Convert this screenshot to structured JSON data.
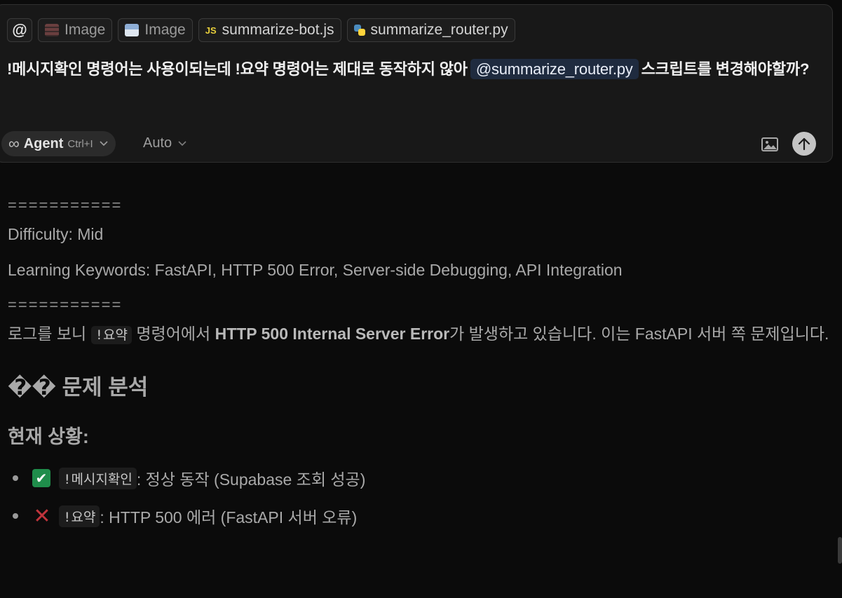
{
  "composer": {
    "at_symbol": "@",
    "chips": [
      {
        "label": "Image",
        "icon": "image-icon-red"
      },
      {
        "label": "Image",
        "icon": "image-icon-blue"
      },
      {
        "label": "summarize-bot.js",
        "icon": "js-file-icon",
        "badge": "JS"
      },
      {
        "label": "summarize_router.py",
        "icon": "python-file-icon"
      }
    ],
    "prompt_part1": "!메시지확인 명령어는 사용이되는데 !요약 명령어는 제대로 동작하지 않아",
    "prompt_mention": "@summarize_router.py",
    "prompt_part2": "스크립트를 변경해야할까?",
    "agent": {
      "symbol": "∞",
      "label": "Agent",
      "shortcut": "Ctrl+I"
    },
    "model": "Auto"
  },
  "response": {
    "separator": "===========",
    "difficulty": "Difficulty: Mid",
    "keywords": "Learning Keywords: FastAPI, HTTP 500 Error, Server-side Debugging, API Integration",
    "log_pre": "로그를 보니",
    "log_code": "!요약",
    "log_mid": "명령어에서",
    "log_bold": "HTTP 500 Internal Server Error",
    "log_post": "가 발생하고 있습니다. 이는 FastAPI 서버 쪽 문제입니다.",
    "section_title": "�� 문제 분석",
    "subsection_title": "현재 상황:",
    "items": [
      {
        "status": "check",
        "mark": "✔",
        "code": "!메시지확인",
        "text": ": 정상 동작 (Supabase 조회 성공)"
      },
      {
        "status": "cross",
        "mark": "✕",
        "code": "!요약",
        "text": ": HTTP 500 에러 (FastAPI 서버 오류)"
      }
    ]
  },
  "colors": {
    "background": "#0b0b0b",
    "composer_bg": "#181818",
    "mention_bg": "#1f2b3f",
    "check_green": "#1f8d4b",
    "cross_red": "#c0343c"
  }
}
